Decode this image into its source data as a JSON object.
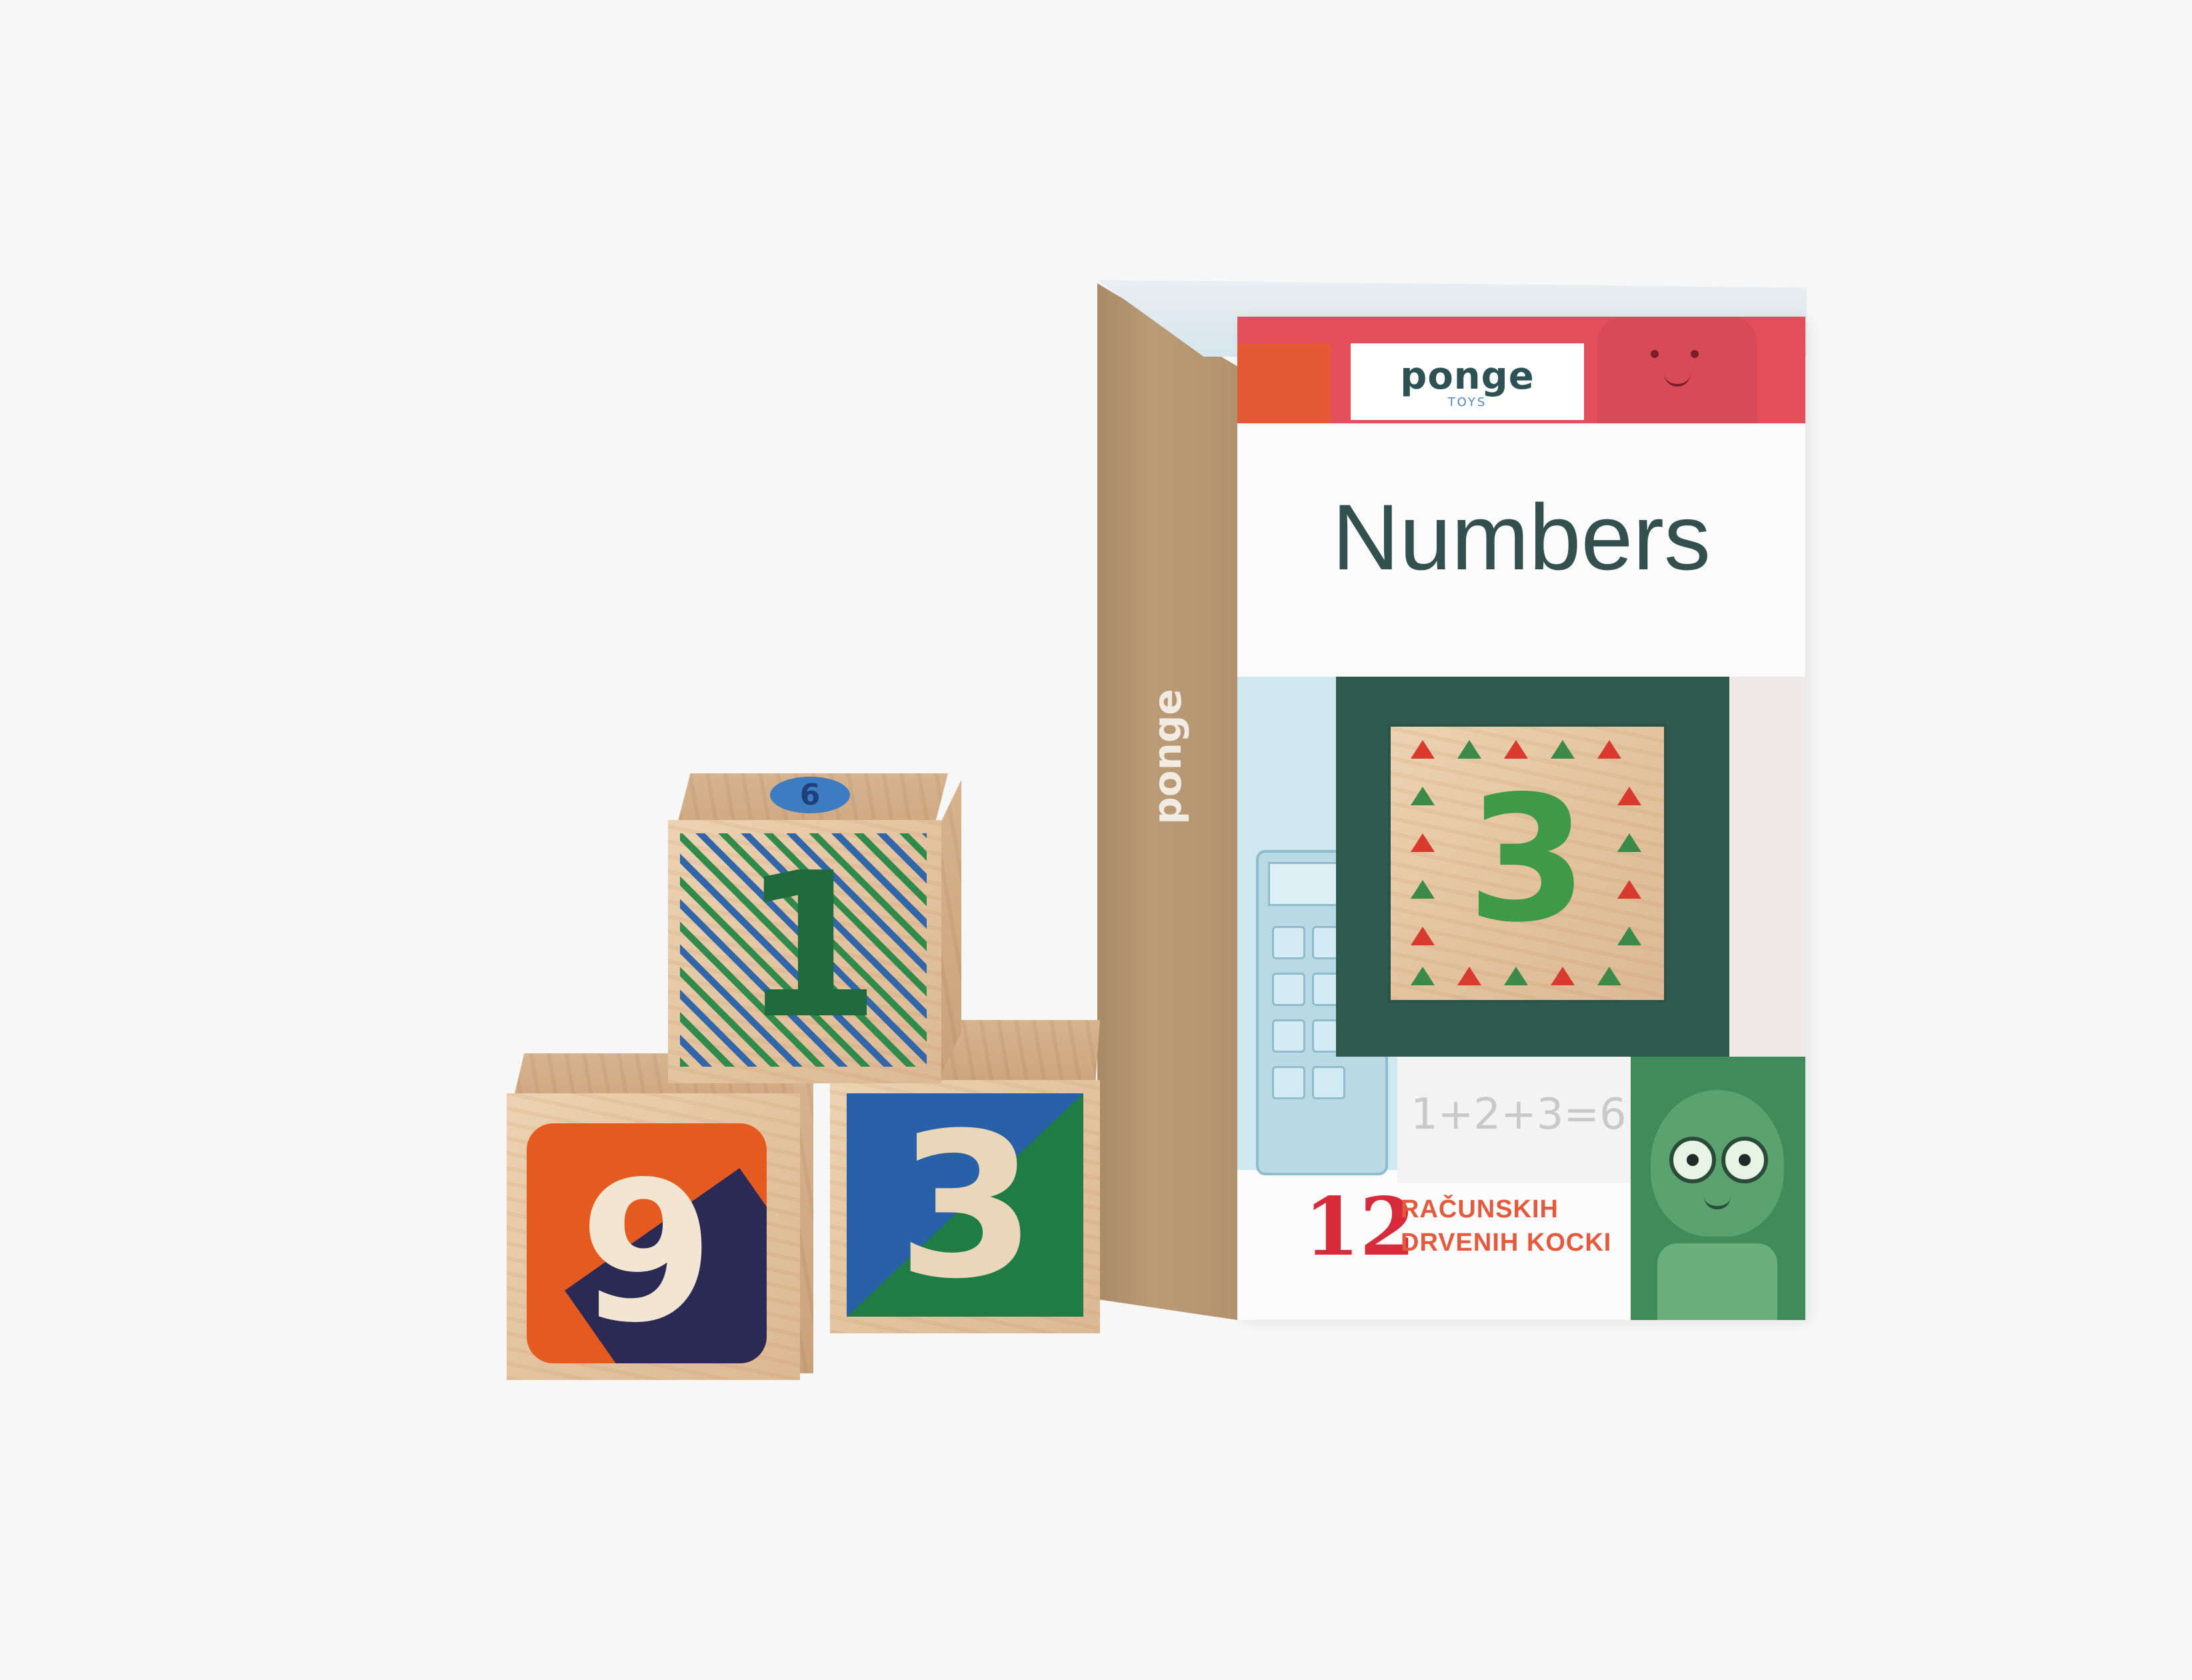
{
  "box": {
    "brand": "ponge",
    "brand_sub": "TOYS",
    "side_brand": "ponge",
    "title": "Numbers",
    "equation": "1+2+3=6",
    "count": "12",
    "count_label_line1": "RAČUNSKIH",
    "count_label_line2": "DRVENIH KOCKI",
    "tile_digit": "3"
  },
  "cubes": {
    "top_digit": "1",
    "left_digit": "9",
    "right_digit": "3",
    "top_face_digit": "6"
  },
  "colors": {
    "red": "#e24e5a",
    "dark_green": "#2f5b4f",
    "green": "#1f6b3b",
    "orange": "#e55a1f",
    "navy": "#2a2a54",
    "blue": "#2861a8",
    "background": "#f7f7f7"
  }
}
